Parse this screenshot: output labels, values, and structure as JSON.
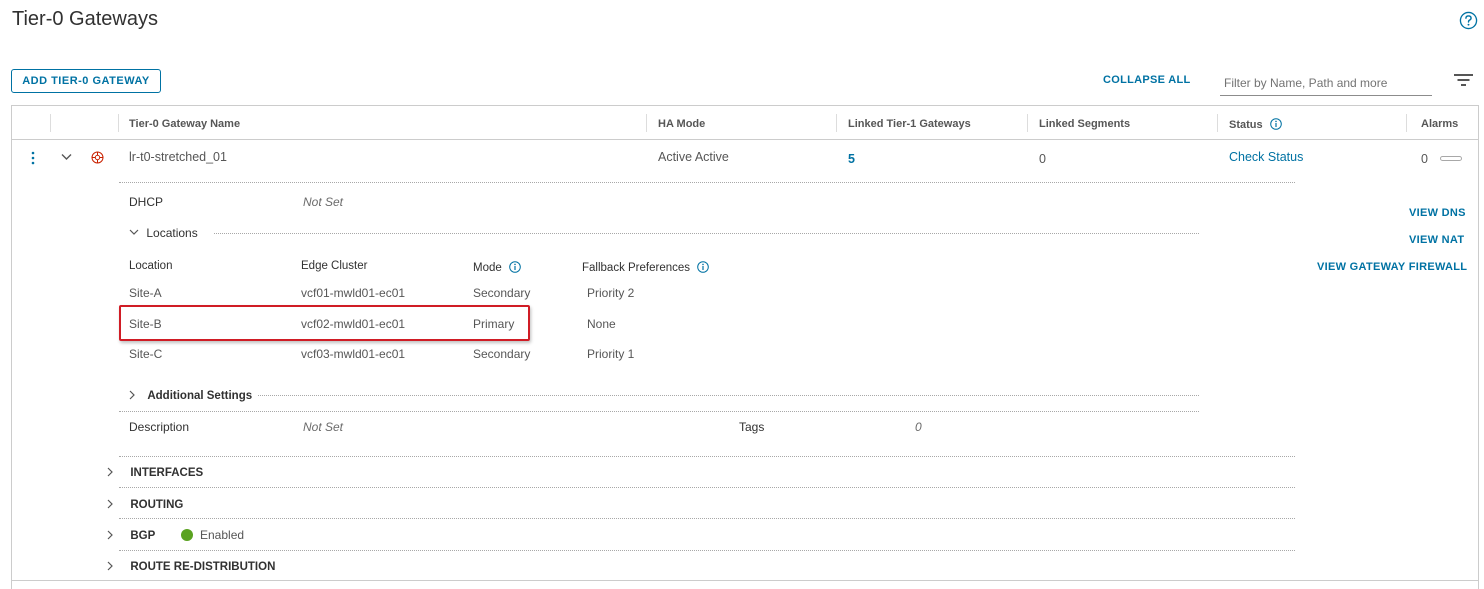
{
  "page": {
    "title": "Tier-0 Gateways",
    "help_icon": "help-circle-icon"
  },
  "toolbar": {
    "add_button": "ADD TIER-0 GATEWAY",
    "collapse_all": "COLLAPSE ALL",
    "filter_placeholder": "Filter by Name, Path and more",
    "filter_icon": "filter-icon"
  },
  "table": {
    "headers": {
      "name": "Tier-0 Gateway Name",
      "ha_mode": "HA Mode",
      "linked_tier1": "Linked Tier-1 Gateways",
      "linked_segments": "Linked Segments",
      "status": "Status",
      "alarms": "Alarms"
    },
    "row": {
      "name": "lr-t0-stretched_01",
      "ha_mode": "Active Active",
      "linked_tier1": "5",
      "linked_segments": "0",
      "status": "Check Status",
      "alarms": "0"
    }
  },
  "details": {
    "dhcp_label": "DHCP",
    "dhcp_value": "Not Set",
    "locations_label": "Locations",
    "locations_headers": {
      "location": "Location",
      "edge_cluster": "Edge Cluster",
      "mode": "Mode",
      "fallback": "Fallback Preferences"
    },
    "locations": [
      {
        "location": "Site-A",
        "edge_cluster": "vcf01-mwld01-ec01",
        "mode": "Secondary",
        "fallback": "Priority 2"
      },
      {
        "location": "Site-B",
        "edge_cluster": "vcf02-mwld01-ec01",
        "mode": "Primary",
        "fallback": "None"
      },
      {
        "location": "Site-C",
        "edge_cluster": "vcf03-mwld01-ec01",
        "mode": "Secondary",
        "fallback": "Priority 1"
      }
    ],
    "additional_settings": "Additional Settings",
    "description_label": "Description",
    "description_value": "Not Set",
    "tags_label": "Tags",
    "tags_value": "0"
  },
  "sections": {
    "interfaces": "INTERFACES",
    "routing": "ROUTING",
    "bgp": "BGP",
    "bgp_status": "Enabled",
    "route_redistribution": "ROUTE RE-DISTRIBUTION"
  },
  "side_actions": {
    "view_dns": "VIEW DNS",
    "view_nat": "VIEW NAT",
    "view_firewall": "VIEW GATEWAY FIREWALL"
  },
  "colors": {
    "accent": "#0072a3",
    "highlight_box": "#d01c25",
    "bgp_enabled": "#5aa220",
    "gateway_icon": "#c92100"
  }
}
